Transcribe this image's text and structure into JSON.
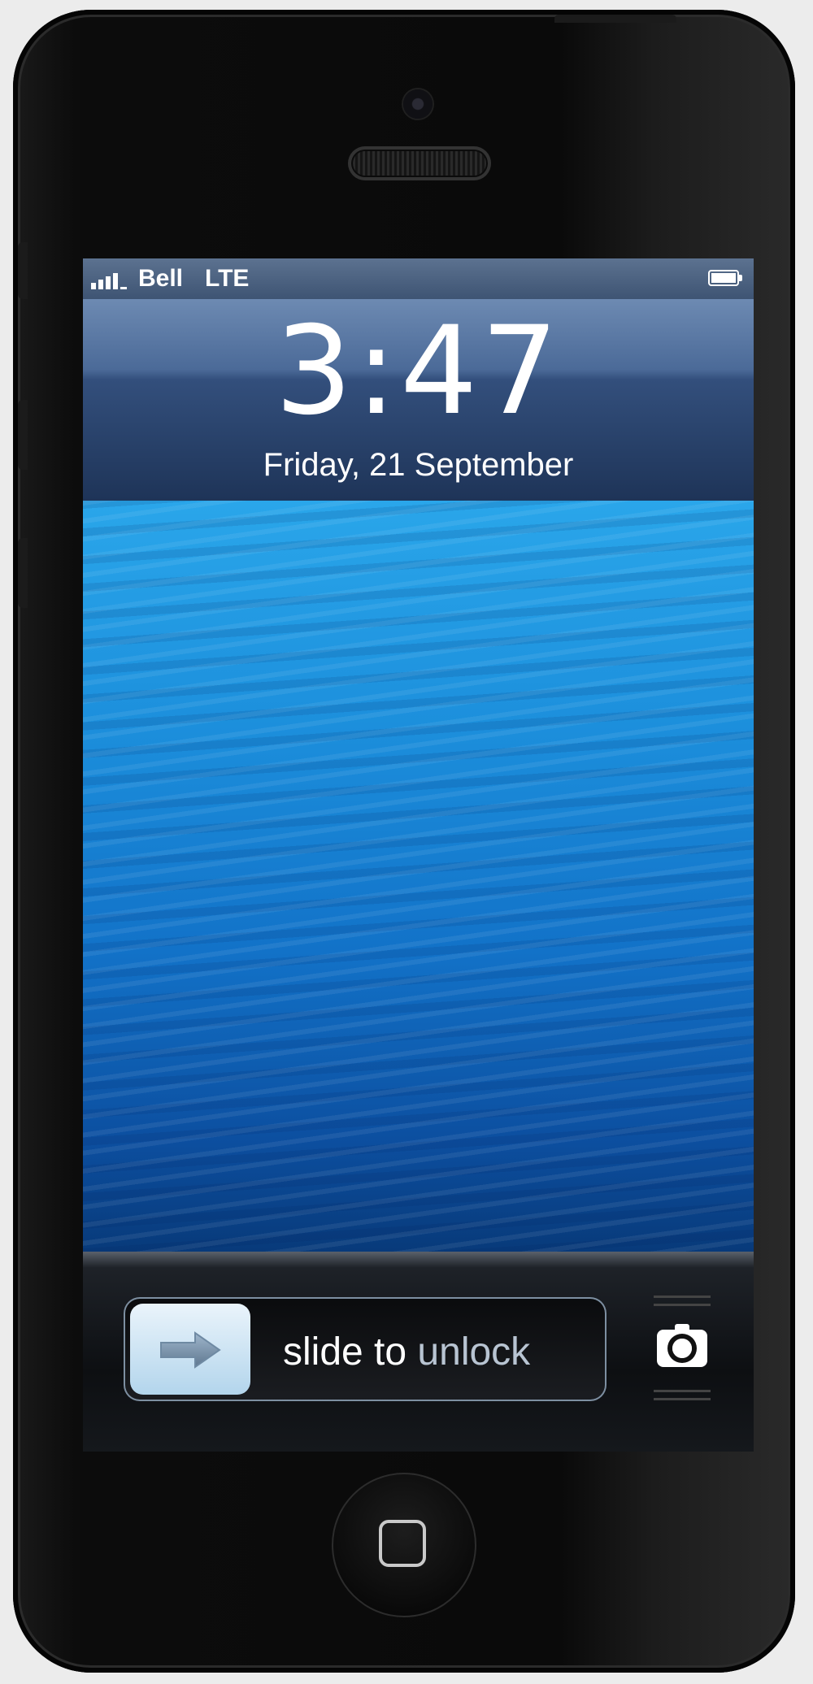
{
  "status_bar": {
    "carrier": "Bell",
    "network": "LTE",
    "signal_bars": 4,
    "battery_icon": "battery-icon",
    "battery_level": 1.0
  },
  "lock_screen": {
    "time": "3:47",
    "date": "Friday, 21 September"
  },
  "unlock_slider": {
    "label_start": "slide to ",
    "label_end": "unlock",
    "knob_icon": "arrow-right-icon"
  },
  "camera_shortcut": {
    "icon": "camera-icon"
  },
  "hardware": {
    "home_button_icon": "home-square-icon"
  },
  "colors": {
    "wallpaper_top": "#2aa6ea",
    "wallpaper_bottom": "#083a7a",
    "status_bar": "#4b6282"
  }
}
